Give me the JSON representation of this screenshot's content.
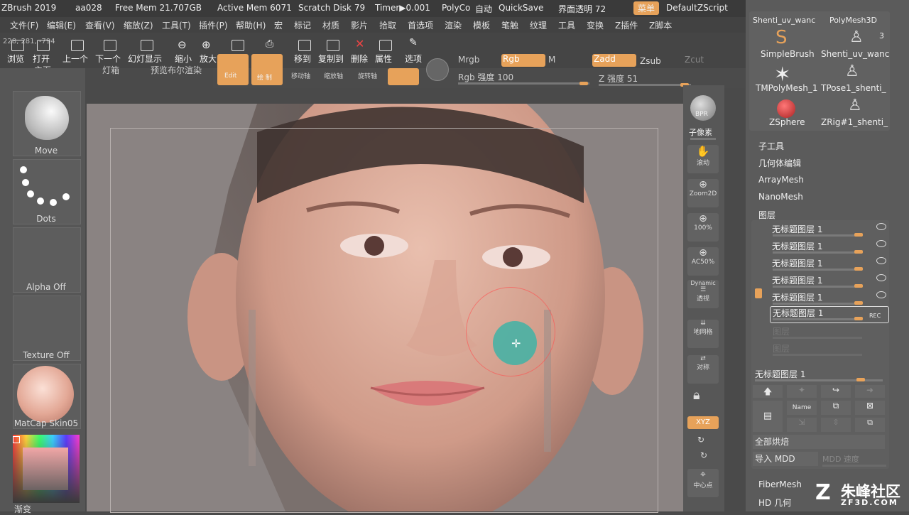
{
  "title_bar": {
    "app": "ZBrush 2019",
    "file": "aa028",
    "free_mem": "Free Mem 21.707GB",
    "active_mem": "Active Mem 6071",
    "scratch_disk": "Scratch Disk 79",
    "timer": "Timer▶0.001",
    "polycount": "PolyCo",
    "auto": "自动",
    "quicksave": "QuickSave",
    "ui_transparency": "界面透明 72",
    "menu_btn": "菜单",
    "script": "DefaultZScript"
  },
  "menu": [
    "文件(F)",
    "编辑(E)",
    "查看(V)",
    "缩放(Z)",
    "工具(T)",
    "插件(P)",
    "帮助(H)",
    "宏",
    "标记",
    "材质",
    "影片",
    "拾取",
    "首选项",
    "渲染",
    "模板",
    "笔触",
    "纹理",
    "工具",
    "变换",
    "Z插件",
    "Z脚本"
  ],
  "coords": "228, 281, -794",
  "toolbar": {
    "browse": "浏览",
    "open": "打开",
    "prev": "上一个",
    "next": "下一个",
    "lightbox": "幻灯显示",
    "zoom_out": "缩小",
    "zoom_in": "放大",
    "edit": "编辑",
    "print": "打印",
    "move_to": "移到",
    "copy_to": "复制到",
    "delete": "删除",
    "properties": "属性",
    "options": "选项",
    "home": "主页",
    "lightbox2": "灯箱",
    "preview": "预览布尔渲染"
  },
  "draw_modes": {
    "edit_label": "Edit",
    "draw_label": "绘 制",
    "move": "移动轴",
    "scale": "缩放轴",
    "rotate": "旋转轴",
    "mrgb": "Mrgb",
    "rgb": "Rgb",
    "m": "M",
    "zadd": "Zadd",
    "zsub": "Zsub",
    "zcut": "Zcut",
    "rgb_intensity": "Rgb 强度 100",
    "z_intensity": "Z 强度 51"
  },
  "left_shelf": {
    "brush": "Move",
    "stroke": "Dots",
    "alpha": "Alpha Off",
    "texture": "Texture Off",
    "material": "MatCap Skin05",
    "gradient": "渐变"
  },
  "right_shelf": [
    "BPR",
    "子像素",
    "滚动",
    "Zoom2D",
    "100%",
    "AC50%",
    "Dynamic",
    "透视",
    "地网格",
    "对称",
    "XYZ",
    "中心点"
  ],
  "tools_panel": {
    "items": [
      {
        "label": "Shenti_uv_wanc"
      },
      {
        "label": "PolyMesh3D"
      },
      {
        "label": "SimpleBrush"
      },
      {
        "label": "Shenti_uv_wanc"
      },
      {
        "label": "TMPolyMesh_1"
      },
      {
        "label": "TPose1_shenti_"
      },
      {
        "label": "ZSphere"
      },
      {
        "label": "ZRig#1_shenti_"
      }
    ],
    "count": "3"
  },
  "subpanels": {
    "subtool": "子工具",
    "geometry": "几何体编辑",
    "arraymesh": "ArrayMesh",
    "nanomesh": "NanoMesh",
    "layers": "图层"
  },
  "layers": [
    {
      "name": "无标题图层 1"
    },
    {
      "name": "无标题图层 1"
    },
    {
      "name": "无标题图层 1"
    },
    {
      "name": "无标题图层 1"
    },
    {
      "name": "无标题图层 1"
    },
    {
      "name": "无标题图层 1",
      "rec": "REC"
    }
  ],
  "layer_disabled": [
    "图层",
    "图层"
  ],
  "layer_current": "无标题图层 1",
  "layer_buttons": {
    "name": "Name"
  },
  "bake_all": "全部烘焙",
  "import_mdd": "导入 MDD",
  "mdd_speed": "MDD 速度",
  "fibermesh": "FiberMesh",
  "hd_geometry": "HD 几何",
  "watermark": {
    "brand": "朱峰社区",
    "url": "ZF3D.COM"
  },
  "colors": {
    "accent": "#e7a25a",
    "panel": "#5b5b5b",
    "brush": "#3fb3a6"
  }
}
